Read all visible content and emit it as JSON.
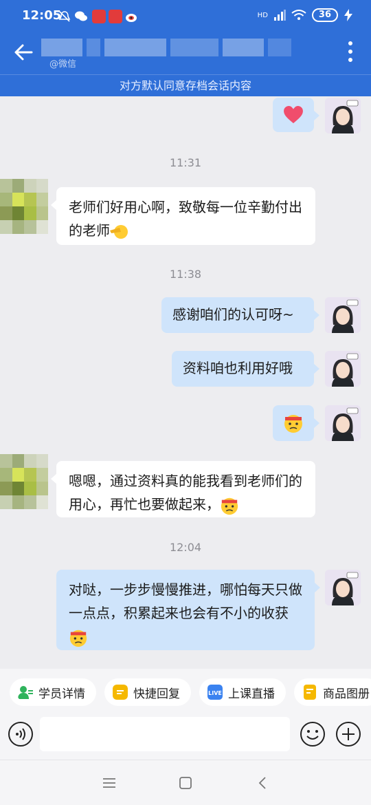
{
  "status": {
    "time": "12:05",
    "hd_label": "HD",
    "battery": "36"
  },
  "header": {
    "subtitle": "@微信",
    "notice": "对方默认同意存档会话内容"
  },
  "messages": {
    "t1": "11:31",
    "m1": "老师们好用心啊，致敬每一位辛勤付出的老师",
    "t2": "11:38",
    "m2": "感谢咱们的认可呀~",
    "m3": "资料咱也利用好哦",
    "m4": "嗯嗯，通过资料真的能我看到老师们的用心，再忙也要做起来，",
    "t3": "12:04",
    "m5": "对哒，一步步慢慢推进，哪怕每天只做一点点，积累起来也会有不小的收获"
  },
  "quick_actions": [
    {
      "label": "学员详情",
      "icon": "student-icon",
      "color": "#2fb35c"
    },
    {
      "label": "快捷回复",
      "icon": "reply-icon",
      "color": "#f5b800"
    },
    {
      "label": "上课直播",
      "icon": "live-icon",
      "color": "#3a82f0"
    },
    {
      "label": "商品图册",
      "icon": "catalog-icon",
      "color": "#f5b800"
    }
  ],
  "input": {
    "placeholder": ""
  },
  "colors": {
    "brand": "#2f6fd8",
    "my_bubble": "#cfe4fb",
    "other_bubble": "#ffffff"
  }
}
